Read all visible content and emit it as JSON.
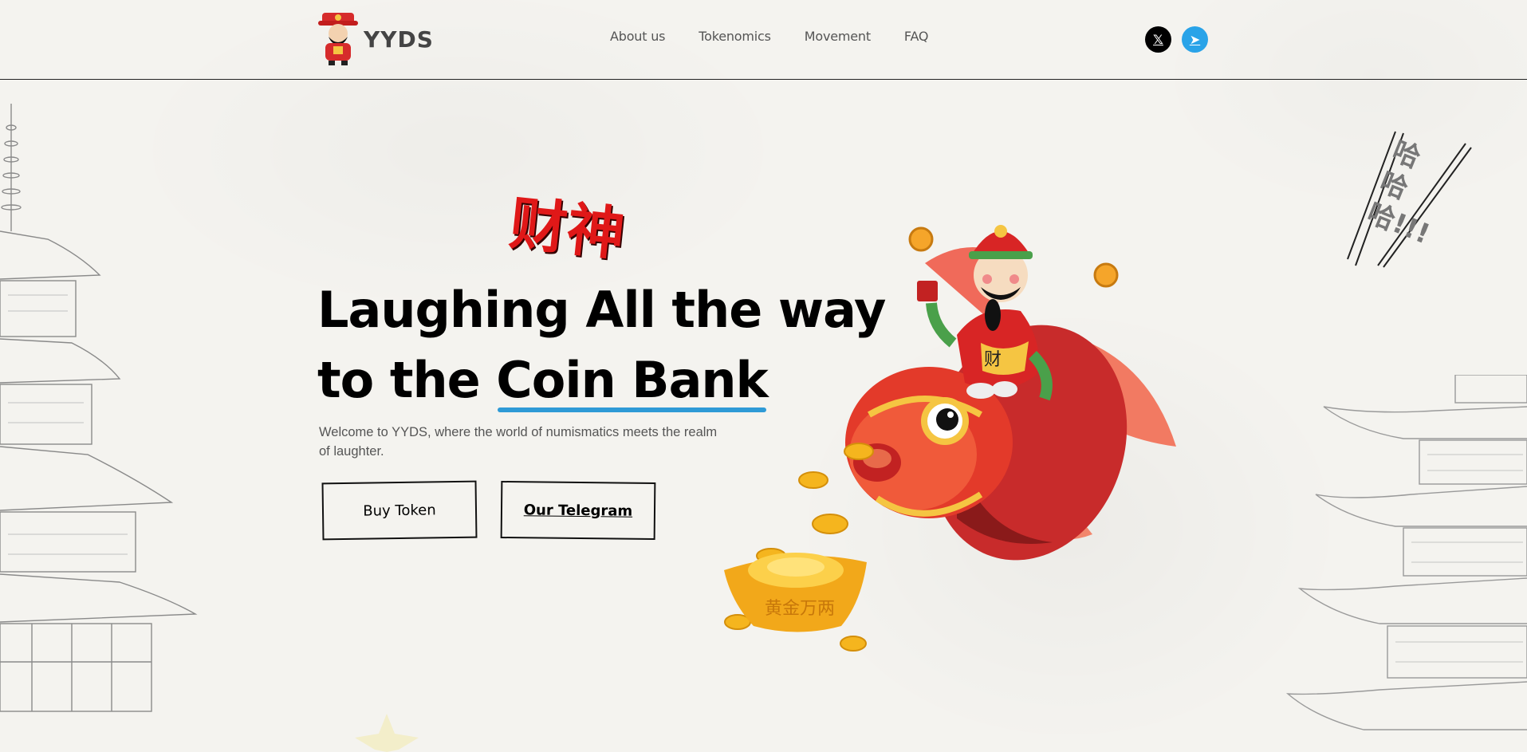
{
  "header": {
    "logo_text": "YYDS",
    "nav": [
      {
        "label": "About us"
      },
      {
        "label": "Tokenomics"
      },
      {
        "label": "Movement"
      },
      {
        "label": "FAQ"
      }
    ],
    "socials": [
      {
        "icon": "x-icon",
        "glyph": "𝕏"
      },
      {
        "icon": "telegram-icon",
        "glyph": "➤"
      }
    ]
  },
  "hero": {
    "chinese_title": "财神",
    "headline_line1": "Laughing All the way",
    "headline_line2_prefix": "to the ",
    "headline_line2_highlight": "Coin Bank",
    "subtitle": "Welcome to YYDS, where the world of numismatics meets the realm of laughter.",
    "buy_button": "Buy Token",
    "telegram_button": "Our Telegram",
    "laugh_text": "哈哈哈!!!",
    "ingot_text": "黄金万两"
  },
  "colors": {
    "accent_blue": "#2e9ad6",
    "accent_red": "#e01818",
    "gold": "#f2b01e"
  }
}
